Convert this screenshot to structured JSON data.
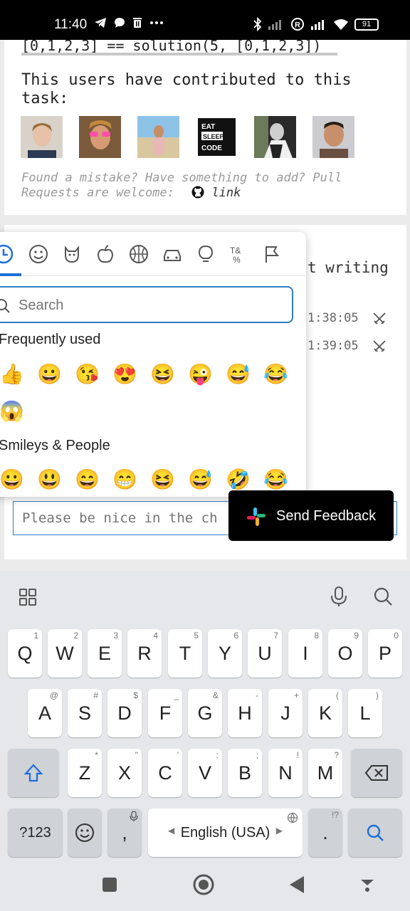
{
  "status_bar": {
    "time": "11:40",
    "battery": "91"
  },
  "task_card": {
    "code_line": "[0,1,2,3]  == solution(5, [0,1,2,3])",
    "contributors_title": "This users have contributed to this task:",
    "note": "Found a mistake? Have something to add? Pull Requests are welcome:",
    "link_label": "link"
  },
  "chat_card": {
    "partial_text": "t writing",
    "times": [
      "1:38:05",
      "1:39:05"
    ],
    "input_placeholder": "Please be nice in the ch"
  },
  "emoji_picker": {
    "search_placeholder": "Search",
    "section_frequent": "Frequently used",
    "frequent_row1": [
      "👍",
      "😀",
      "😘",
      "😍",
      "😆",
      "😜",
      "😅",
      "😂"
    ],
    "frequent_row2": [
      "😱"
    ],
    "section_smileys": "Smileys & People",
    "smileys_row": [
      "😀",
      "😃",
      "😄",
      "😁",
      "😆",
      "😅",
      "🤣",
      "😂"
    ]
  },
  "feedback_button": {
    "label": "Send Feedback"
  },
  "keyboard": {
    "row1": [
      {
        "key": "Q",
        "hint": "1"
      },
      {
        "key": "W",
        "hint": "2"
      },
      {
        "key": "E",
        "hint": "3"
      },
      {
        "key": "R",
        "hint": "4"
      },
      {
        "key": "T",
        "hint": "5"
      },
      {
        "key": "Y",
        "hint": "6"
      },
      {
        "key": "U",
        "hint": "7"
      },
      {
        "key": "I",
        "hint": "8"
      },
      {
        "key": "O",
        "hint": "9"
      },
      {
        "key": "P",
        "hint": "0"
      }
    ],
    "row2": [
      {
        "key": "A",
        "hint": "@"
      },
      {
        "key": "S",
        "hint": "#"
      },
      {
        "key": "D",
        "hint": "$"
      },
      {
        "key": "F",
        "hint": "_"
      },
      {
        "key": "G",
        "hint": "&"
      },
      {
        "key": "H",
        "hint": "-"
      },
      {
        "key": "J",
        "hint": "+"
      },
      {
        "key": "K",
        "hint": "("
      },
      {
        "key": "L",
        "hint": ")"
      }
    ],
    "row3": [
      {
        "key": "Z",
        "hint": "*"
      },
      {
        "key": "X",
        "hint": "\""
      },
      {
        "key": "C",
        "hint": "'"
      },
      {
        "key": "V",
        "hint": ":"
      },
      {
        "key": "B",
        "hint": ";"
      },
      {
        "key": "N",
        "hint": "!"
      },
      {
        "key": "M",
        "hint": "?"
      }
    ],
    "symbols_label": "?123",
    "comma_label": ",",
    "space_label": "English (USA)",
    "period_label": ".",
    "period_hint": "!?"
  }
}
